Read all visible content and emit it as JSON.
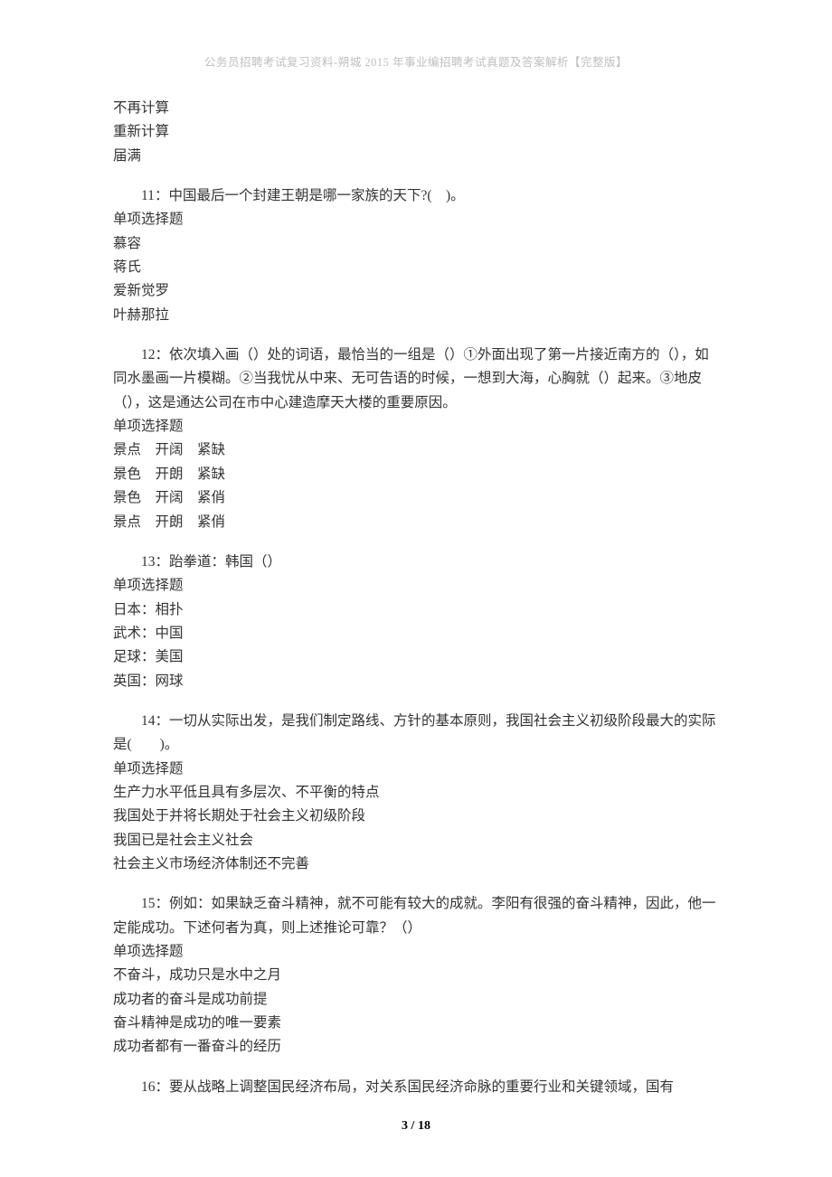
{
  "header": "公务员招聘考试复习资料-朔城 2015 年事业编招聘考试真题及答案解析【完整版】",
  "orphan": {
    "lines": [
      "不再计算",
      "重新计算",
      "届满"
    ]
  },
  "questions": [
    {
      "num": "11",
      "stem": "中国最后一个封建王朝是哪一家族的天下?(　)。",
      "type": "单项选择题",
      "options": [
        "慕容",
        "蒋氏",
        "爱新觉罗",
        "叶赫那拉"
      ]
    },
    {
      "num": "12",
      "stem": "依次填入画（）处的词语，最恰当的一组是（）①外面出现了第一片接近南方的（），如同水墨画一片模糊。②当我忧从中来、无可告语的时候，一想到大海，心胸就（）起来。③地皮（），这是通达公司在市中心建造摩天大楼的重要原因。",
      "type": "单项选择题",
      "options": [
        "景点　开阔　紧缺",
        "景色　开朗　紧缺",
        "景色　开阔　紧俏",
        "景点　开朗　紧俏"
      ]
    },
    {
      "num": "13",
      "stem": "跆拳道：韩国（）",
      "type": "单项选择题",
      "options": [
        "日本：相扑",
        "武术：中国",
        "足球：美国",
        "英国：网球"
      ]
    },
    {
      "num": "14",
      "stem": "一切从实际出发，是我们制定路线、方针的基本原则，我国社会主义初级阶段最大的实际是(　　)。",
      "type": "单项选择题",
      "options": [
        "生产力水平低且具有多层次、不平衡的特点",
        "我国处于并将长期处于社会主义初级阶段",
        "我国已是社会主义社会",
        "社会主义市场经济体制还不完善"
      ]
    },
    {
      "num": "15",
      "stem": "例如：如果缺乏奋斗精神，就不可能有较大的成就。李阳有很强的奋斗精神，因此，他一定能成功。下述何者为真，则上述推论可靠？（）",
      "type": "单项选择题",
      "options": [
        "不奋斗，成功只是水中之月",
        "成功者的奋斗是成功前提",
        "奋斗精神是成功的唯一要素",
        "成功者都有一番奋斗的经历"
      ]
    },
    {
      "num": "16",
      "stem": "要从战略上调整国民经济布局，对关系国民经济命脉的重要行业和关键领域，国有",
      "type": "",
      "options": []
    }
  ],
  "footer": {
    "page_current": "3",
    "page_sep": " / ",
    "page_total": "18"
  }
}
